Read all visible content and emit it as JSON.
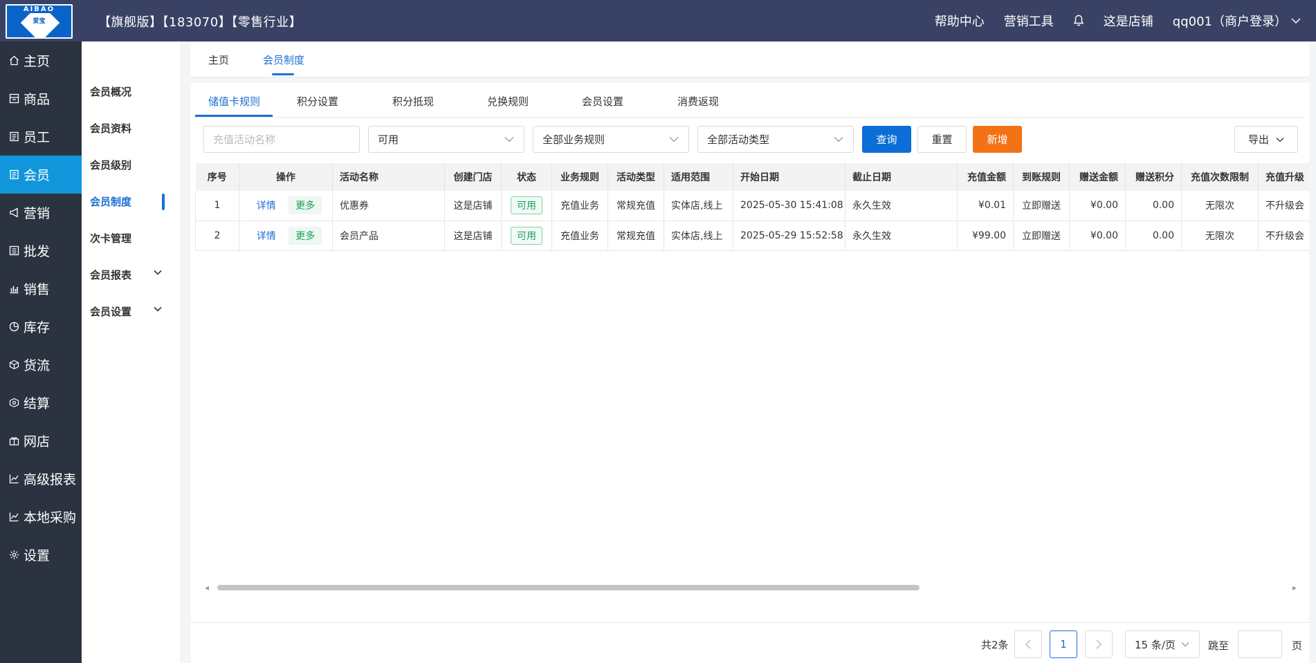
{
  "header": {
    "logo_text": "AIBAO",
    "logo_sub": "爱宝",
    "title": "【旗舰版】【183070】【零售行业】",
    "help": "帮助中心",
    "marketing_tools": "营销工具",
    "store": "这是店铺",
    "user": "qq001（商户登录）"
  },
  "sidebar": {
    "items": [
      {
        "label": "主页",
        "icon": "home-icon"
      },
      {
        "label": "商品",
        "icon": "goods-icon"
      },
      {
        "label": "员工",
        "icon": "staff-icon"
      },
      {
        "label": "会员",
        "icon": "member-icon"
      },
      {
        "label": "营销",
        "icon": "megaphone-icon"
      },
      {
        "label": "批发",
        "icon": "wholesale-icon"
      },
      {
        "label": "销售",
        "icon": "bar-chart-icon"
      },
      {
        "label": "库存",
        "icon": "pie-icon"
      },
      {
        "label": "货流",
        "icon": "cube-icon"
      },
      {
        "label": "结算",
        "icon": "settle-icon"
      },
      {
        "label": "网店",
        "icon": "gift-icon"
      },
      {
        "label": "高级报表",
        "icon": "line-chart-icon"
      },
      {
        "label": "本地采购",
        "icon": "line-chart-icon"
      },
      {
        "label": "设置",
        "icon": "gear-icon"
      }
    ]
  },
  "subbar": {
    "items": [
      "会员概况",
      "会员资料",
      "会员级别",
      "会员制度",
      "次卡管理",
      "会员报表",
      "会员设置"
    ]
  },
  "topnav": {
    "home": "主页",
    "current": "会员制度"
  },
  "tabs": [
    "储值卡规则",
    "积分设置",
    "积分抵现",
    "兑换规则",
    "会员设置",
    "消费返现"
  ],
  "filters": {
    "name_placeholder": "充值活动名称",
    "status": "可用",
    "business": "全部业务规则",
    "activity_type": "全部活动类型",
    "query": "查询",
    "reset": "重置",
    "add": "新增",
    "export": "导出"
  },
  "table": {
    "headers": [
      "序号",
      "操作",
      "活动名称",
      "创建门店",
      "状态",
      "业务规则",
      "活动类型",
      "适用范围",
      "开始日期",
      "截止日期",
      "充值金额",
      "到账规则",
      "赠送金额",
      "赠送积分",
      "充值次数限制",
      "充值升级"
    ],
    "detail": "详情",
    "more": "更多",
    "rows": [
      {
        "no": "1",
        "name": "优惠券",
        "store": "这是店铺",
        "status": "可用",
        "business": "充值业务",
        "type": "常规充值",
        "scope": "实体店,线上",
        "start": "2025-05-30 15:41:08",
        "end": "永久生效",
        "amount": "¥0.01",
        "arrive": "立即赠送",
        "gift_amount": "¥0.00",
        "gift_points": "0.00",
        "limit": "无限次",
        "upgrade": "不升级会"
      },
      {
        "no": "2",
        "name": "会员产品",
        "store": "这是店铺",
        "status": "可用",
        "business": "充值业务",
        "type": "常规充值",
        "scope": "实体店,线上",
        "start": "2025-05-29 15:52:58",
        "end": "永久生效",
        "amount": "¥99.00",
        "arrive": "立即赠送",
        "gift_amount": "¥0.00",
        "gift_points": "0.00",
        "limit": "无限次",
        "upgrade": "不升级会"
      }
    ]
  },
  "pagination": {
    "total": "共2条",
    "current": "1",
    "page_size": "15 条/页",
    "jump": "跳至",
    "page": "页"
  }
}
